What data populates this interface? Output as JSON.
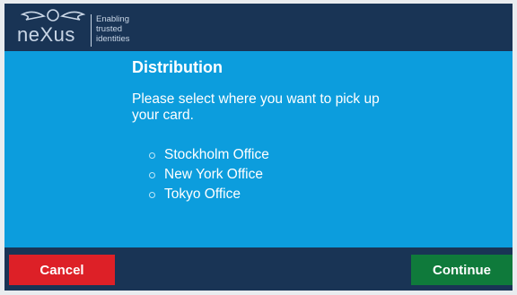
{
  "header": {
    "logo_text": "neXus",
    "tagline": "Enabling\ntrusted\nidentities"
  },
  "main": {
    "title": "Distribution",
    "prompt": "Please select where you want to pick up your card.",
    "options": [
      {
        "label": "Stockholm Office"
      },
      {
        "label": "New York Office"
      },
      {
        "label": "Tokyo Office"
      }
    ]
  },
  "footer": {
    "cancel_label": "Cancel",
    "continue_label": "Continue"
  },
  "colors": {
    "header_bg": "#193455",
    "main_bg": "#0c9ddd",
    "cancel_bg": "#dd2027",
    "continue_bg": "#0f7a3b"
  }
}
